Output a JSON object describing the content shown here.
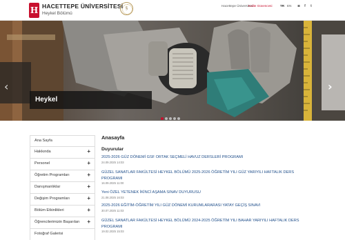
{
  "header": {
    "university": "HACETTEPE ÜNİVERSİTESİ",
    "department": "Heykel Bölümü",
    "logo_letter": "H",
    "seal_text": "§"
  },
  "topnav": {
    "university_link": "Hacettepe Üniversitesi",
    "quality_link": "Kalite Güvencesi",
    "lang_tr": "TR",
    "lang_en": "EN",
    "social": [
      "instagram-icon",
      "facebook-icon",
      "twitter-icon"
    ],
    "social_glyphs": [
      "◙",
      "f",
      "t"
    ]
  },
  "slider": {
    "caption": "Heykel",
    "prev_glyph": "‹",
    "next_glyph": "›",
    "slide_count": 5,
    "active_index": 0
  },
  "sidebar": {
    "items": [
      {
        "label": "Ana Sayfa",
        "expandable": false
      },
      {
        "label": "Hakkında",
        "expandable": true
      },
      {
        "label": "Personel",
        "expandable": true
      },
      {
        "label": "Öğretim Programları",
        "expandable": true
      },
      {
        "label": "Danışmanlıklar",
        "expandable": true
      },
      {
        "label": "Değişim Programları",
        "expandable": true
      },
      {
        "label": "Bölüm Etkinlikleri",
        "expandable": true
      },
      {
        "label": "Öğrencilerimizin Başarıları",
        "expandable": true
      },
      {
        "label": "Fotoğraf Galerisi",
        "expandable": false
      }
    ],
    "plus_glyph": "+"
  },
  "main": {
    "title": "Anasayfa",
    "section": "Duyurular",
    "news": [
      {
        "title": "2025-2026 GÜZ DÖNEMİ GSF ORTAK SEÇMELİ HAVUZ DERSLERİ PROGRAMI",
        "date": "24.09.2025 14:03"
      },
      {
        "title": "GÜZEL SANATLAR FAKÜLTESİ HEYKEL BÖLÜMÜ 2025-2026 ÖĞRETİM YILI GÜZ YARIYILI HAFTALIK DERS PROGRAMI",
        "date": "16.09.2025 11:00"
      },
      {
        "title": "Yeni ÖZEL YETENEK İKİNCİ AŞAMA SINAV DUYURUSU",
        "date": "21.08.2025 16:03"
      },
      {
        "title": "2025-2026 EĞİTİM-ÖĞRETİM YILI GÜZ DÖNEMİ KURUMLARARASI YATAY GEÇİŞ SINAVI",
        "date": "30.07.2025 11:03"
      },
      {
        "title": "GÜZEL SANATLAR FAKÜLTESİ HEYKEL BÖLÜMÜ 2024-2025 ÖĞRETİM YILI BAHAR YARIYILI HAFTALIK DERS PROGRAMI",
        "date": "19.02.2025 15:03"
      }
    ]
  },
  "colors": {
    "brand_red": "#c8102e",
    "link_blue": "#1f4e8a"
  }
}
